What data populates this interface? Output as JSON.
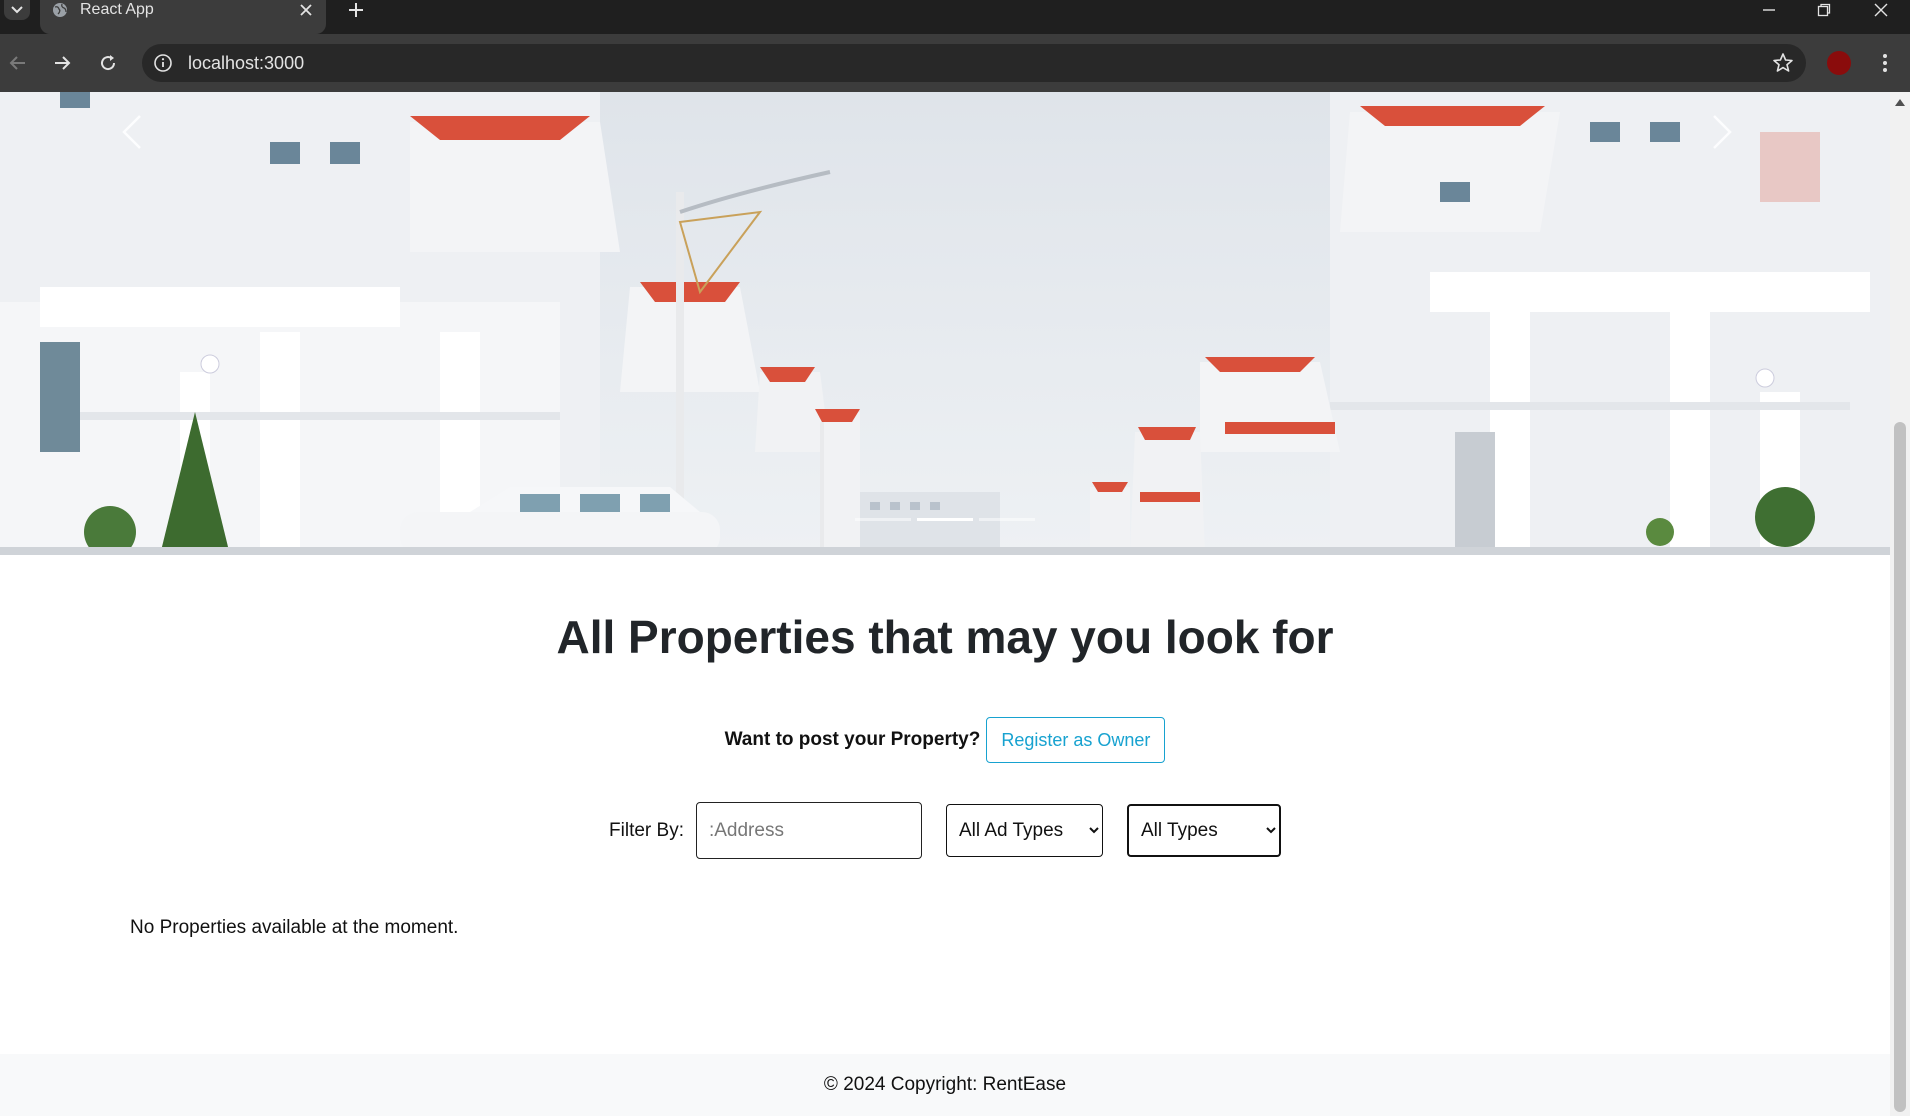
{
  "browser": {
    "tab_title": "React App",
    "url": "localhost:3000"
  },
  "icons": {
    "tab_list": "chevron-down-icon",
    "favicon": "globe-icon",
    "tab_close": "close-icon",
    "new_tab": "plus-icon",
    "minimize": "minimize-icon",
    "restore": "restore-icon",
    "close_window": "close-icon",
    "back": "arrow-left-icon",
    "forward": "arrow-right-icon",
    "reload": "reload-icon",
    "site_info": "info-icon",
    "bookmark": "star-icon",
    "menu": "kebab-menu-icon",
    "carousel_prev": "chevron-left-icon",
    "carousel_next": "chevron-right-icon"
  },
  "colors": {
    "accent": "#17a2d0",
    "profile": "#8a0c0c",
    "footer_bg": "#f8f9fa"
  },
  "carousel": {
    "slide_count": 3,
    "active_index": 1
  },
  "main": {
    "title": "All Properties that may you look for",
    "cta_text": "Want to post your Property?",
    "register_button": "Register as Owner",
    "filter_label": "Filter By:",
    "address_placeholder": ":Address",
    "ad_type_selected": "All Ad Types",
    "type_selected": "All Types",
    "empty_message": "No Properties available at the moment."
  },
  "footer": {
    "text": "© 2024 Copyright: RentEase"
  }
}
